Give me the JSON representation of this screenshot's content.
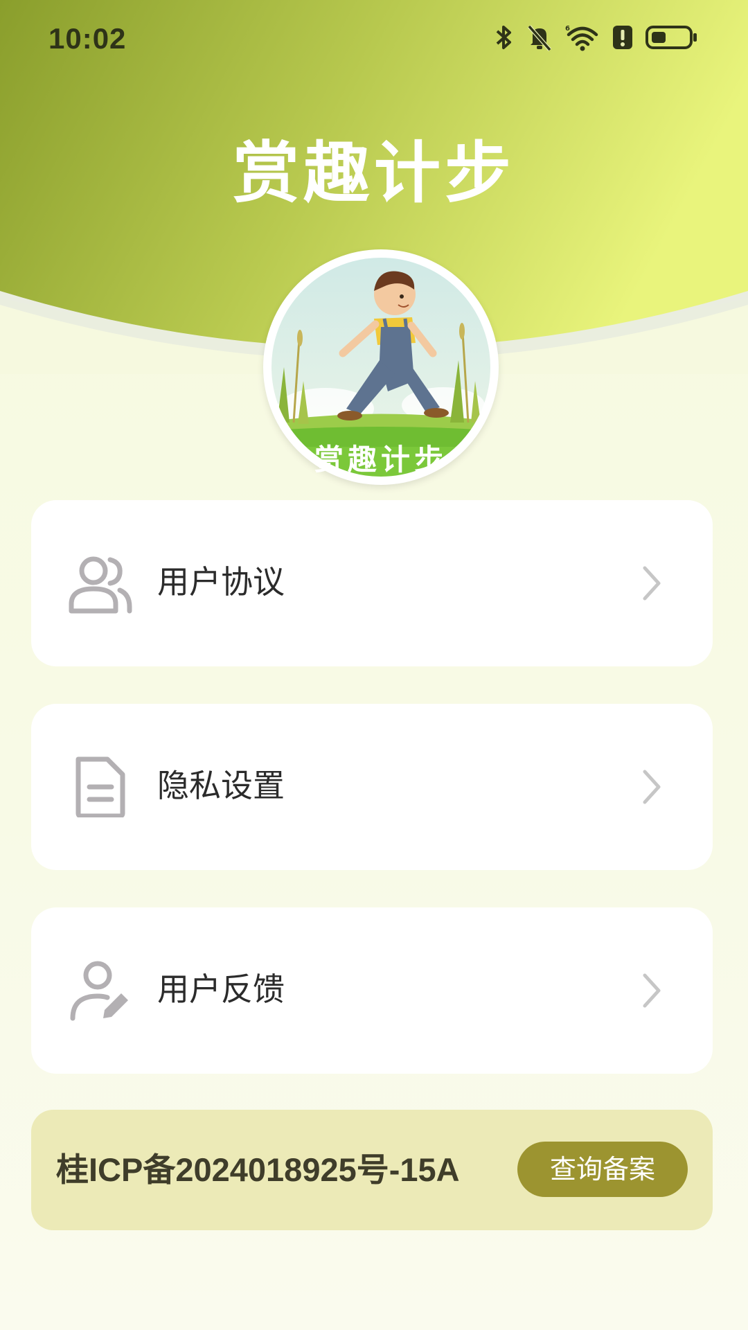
{
  "status_bar": {
    "time": "10:02",
    "icons": [
      "bluetooth-icon",
      "bell-muted-icon",
      "wifi-icon",
      "alert-icon",
      "battery-icon"
    ]
  },
  "header": {
    "title": "赏趣计步",
    "gradient_start": "#8aa02c",
    "gradient_end": "#e8f27a"
  },
  "avatar": {
    "banner_text": "赏趣计步"
  },
  "menu": {
    "items": [
      {
        "label": "用户协议",
        "icon": "users-icon"
      },
      {
        "label": "隐私设置",
        "icon": "document-icon"
      },
      {
        "label": "用户反馈",
        "icon": "user-edit-icon"
      }
    ]
  },
  "icp": {
    "text": "桂ICP备2024018925号-15A",
    "button_label": "查询备案"
  },
  "colors": {
    "accent": "#9c9430",
    "card_bg": "#ffffff",
    "page_bg": "#f7fae2",
    "icp_bg": "#eceab7"
  }
}
